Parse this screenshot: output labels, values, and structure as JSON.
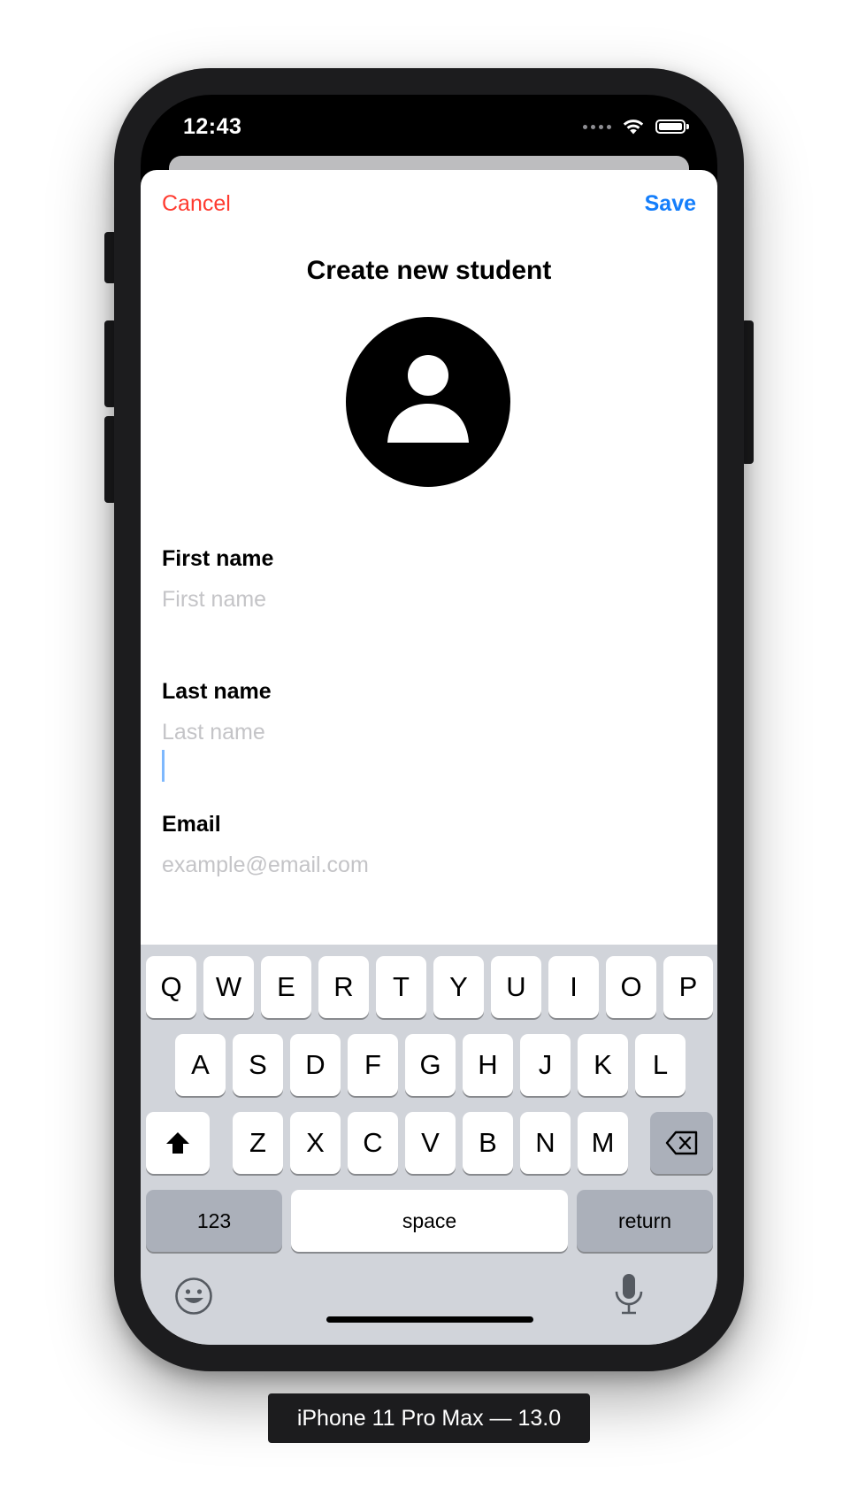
{
  "status_bar": {
    "time": "12:43"
  },
  "nav": {
    "cancel_label": "Cancel",
    "save_label": "Save"
  },
  "title": "Create new student",
  "form": {
    "first_name": {
      "label": "First name",
      "placeholder": "First name",
      "value": ""
    },
    "last_name": {
      "label": "Last name",
      "placeholder": "Last name",
      "value": ""
    },
    "email": {
      "label": "Email",
      "placeholder": "example@email.com",
      "value": ""
    }
  },
  "keyboard": {
    "row1": [
      "Q",
      "W",
      "E",
      "R",
      "T",
      "Y",
      "U",
      "I",
      "O",
      "P"
    ],
    "row2": [
      "A",
      "S",
      "D",
      "F",
      "G",
      "H",
      "J",
      "K",
      "L"
    ],
    "row3": [
      "Z",
      "X",
      "C",
      "V",
      "B",
      "N",
      "M"
    ],
    "numbers_label": "123",
    "space_label": "space",
    "return_label": "return"
  },
  "device_label": "iPhone 11 Pro Max — 13.0",
  "colors": {
    "cancel": "#ff3b30",
    "save": "#147efb",
    "keyboard_bg": "#d1d4da",
    "key_dark": "#abb0ba"
  }
}
